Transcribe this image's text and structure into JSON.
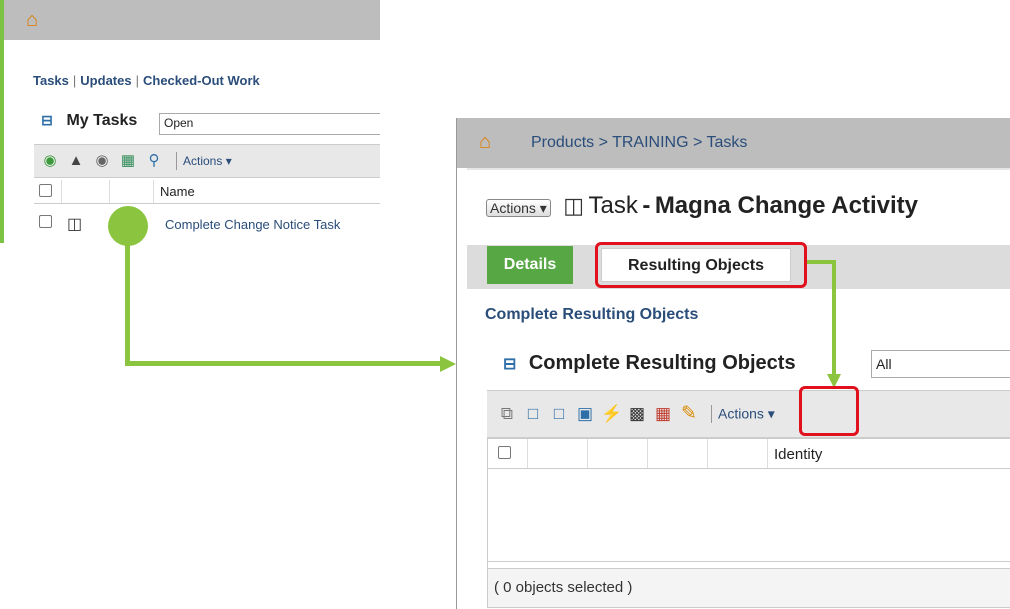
{
  "panel1": {
    "nav_links": [
      "Tasks",
      "Updates",
      "Checked-Out Work"
    ],
    "section_title": "My Tasks",
    "filter_value": "Open",
    "toolbar_actions_label": "Actions",
    "table_header": {
      "name": "Name"
    },
    "rows": [
      {
        "name": "Complete Change Notice Task"
      }
    ]
  },
  "panel2": {
    "breadcrumb": "Products > TRAINING > Tasks",
    "actions_button": "Actions",
    "task_label": "Task",
    "task_dash": "-",
    "task_name": "Magna Change Activity",
    "tabs": {
      "details": "Details",
      "resulting": "Resulting Objects"
    },
    "subheading": "Complete Resulting Objects",
    "section_title": "Complete Resulting Objects",
    "filter_value": "All",
    "toolbar_actions_label": "Actions",
    "table_header": {
      "identity": "Identity"
    },
    "status": "( 0 objects selected )"
  },
  "icons": {
    "home": "home-icon",
    "edit": "pencil-edit-icon"
  },
  "colors": {
    "accent_green": "#8bc53f",
    "highlight_red": "#e0101d",
    "link_blue": "#2a4d7a",
    "home_orange": "#e07b00"
  }
}
